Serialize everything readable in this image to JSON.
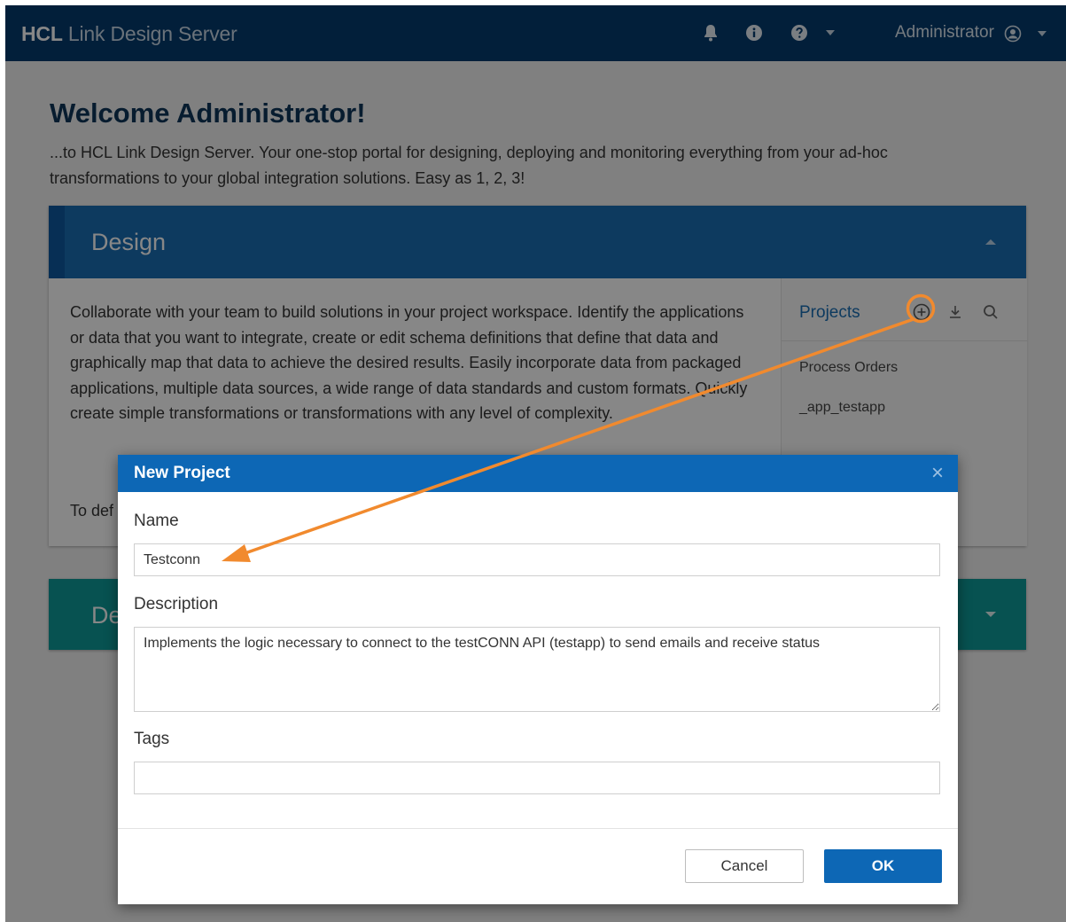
{
  "app": {
    "brand_bold": "HCL",
    "brand_rest": "Link Design Server",
    "user": "Administrator"
  },
  "icons": {
    "bell": "bell-icon",
    "info": "info-icon",
    "help": "help-icon",
    "user": "user-circle-icon"
  },
  "welcome": {
    "title": "Welcome Administrator!",
    "text": "...to HCL Link Design Server. Your one-stop portal for designing, deploying and monitoring everything from your ad-hoc transformations to your global integration solutions. Easy as 1, 2, 3!"
  },
  "design": {
    "title": "Design",
    "body": "Collaborate with your team to build solutions in your project workspace. Identify the applications or data that you want to integrate, create or edit schema definitions that define that data and graphically map that data to achieve the desired results. Easily incorporate data from packaged applications, multiple data sources, a wide range of data standards and custom formats. Quickly create simple transformations or transformations with any level of complexity.",
    "todef": "To def"
  },
  "projects": {
    "title": "Projects",
    "items": [
      "Process Orders",
      "_app_testapp"
    ]
  },
  "deploy": {
    "title": "De"
  },
  "modal": {
    "title": "New Project",
    "close": "×",
    "name_label": "Name",
    "name_value": "Testconn",
    "description_label": "Description",
    "description_value": "Implements the logic necessary to connect to the testCONN API (testapp) to send emails and receive status",
    "tags_label": "Tags",
    "tags_value": "",
    "cancel_label": "Cancel",
    "ok_label": "OK"
  },
  "colors": {
    "topbar": "#053c6e",
    "design": "#1a6eb4",
    "deploy": "#0f9c9a",
    "primary": "#0d67b5",
    "annotation": "#f18a2e"
  }
}
